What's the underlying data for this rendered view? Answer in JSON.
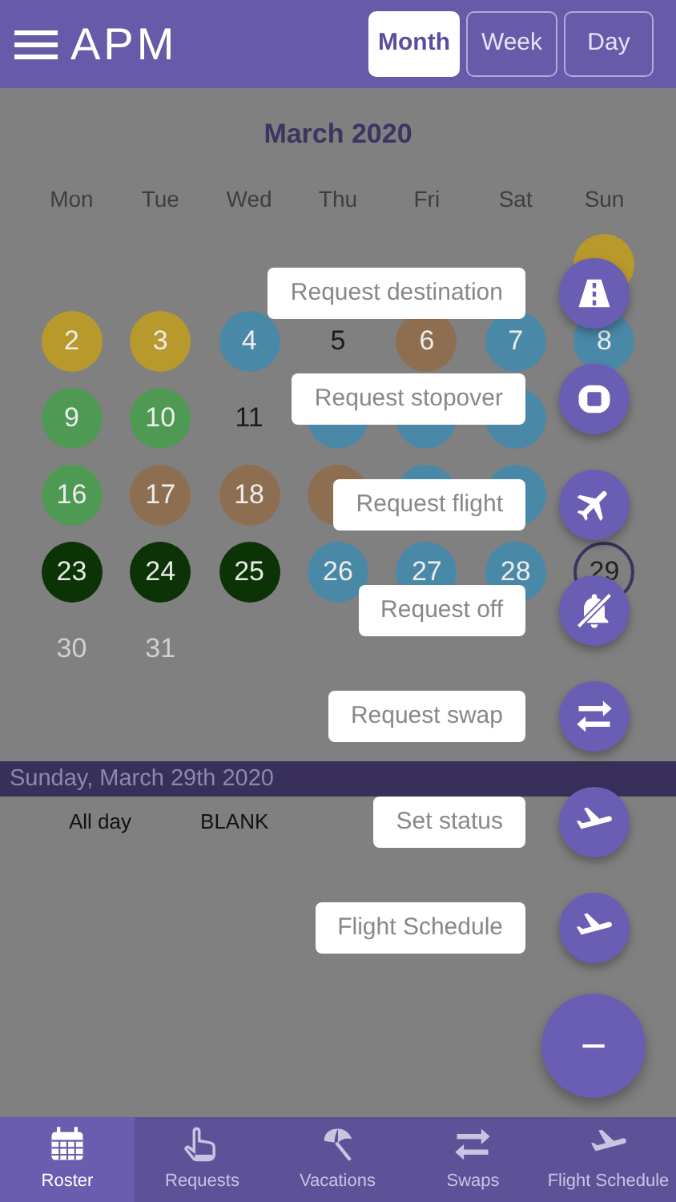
{
  "header": {
    "logo": "APM",
    "view_tabs": [
      {
        "label": "Month",
        "selected": true
      },
      {
        "label": "Week",
        "selected": false
      },
      {
        "label": "Day",
        "selected": false
      }
    ]
  },
  "calendar": {
    "title": "March 2020",
    "weekdays": [
      "Mon",
      "Tue",
      "Wed",
      "Thu",
      "Fri",
      "Sat",
      "Sun"
    ],
    "weeks": [
      [
        {
          "kind": "blank"
        },
        {
          "kind": "blank"
        },
        {
          "kind": "blank"
        },
        {
          "kind": "blank"
        },
        {
          "kind": "blank"
        },
        {
          "kind": "blank"
        },
        {
          "kind": "circle",
          "color": "#b8992c"
        }
      ],
      [
        {
          "kind": "circle",
          "day": "2",
          "color": "#b8992c"
        },
        {
          "kind": "circle",
          "day": "3",
          "color": "#b8992c"
        },
        {
          "kind": "circle",
          "day": "4",
          "color": "#4a88a8"
        },
        {
          "kind": "plain",
          "day": "5"
        },
        {
          "kind": "circle",
          "day": "6",
          "color": "#8e6e50"
        },
        {
          "kind": "circle",
          "day": "7",
          "color": "#4a88a8"
        },
        {
          "kind": "circle",
          "day": "8",
          "color": "#4a88a8"
        }
      ],
      [
        {
          "kind": "circle",
          "day": "9",
          "color": "#4e9a52"
        },
        {
          "kind": "circle",
          "day": "10",
          "color": "#4e9a52"
        },
        {
          "kind": "plain",
          "day": "11"
        },
        {
          "kind": "circle",
          "color": "#4a88a8"
        },
        {
          "kind": "circle",
          "color": "#4a88a8"
        },
        {
          "kind": "circle",
          "color": "#4a88a8"
        },
        {
          "kind": "blank"
        }
      ],
      [
        {
          "kind": "circle",
          "day": "16",
          "color": "#4e9a52"
        },
        {
          "kind": "circle",
          "day": "17",
          "color": "#8e6e50"
        },
        {
          "kind": "circle",
          "day": "18",
          "color": "#8e6e50"
        },
        {
          "kind": "circle",
          "color": "#8e6e50"
        },
        {
          "kind": "circle",
          "color": "#4a88a8"
        },
        {
          "kind": "circle",
          "color": "#4a88a8"
        },
        {
          "kind": "blank"
        }
      ],
      [
        {
          "kind": "strong",
          "day": "23",
          "color": "#0b3306"
        },
        {
          "kind": "strong",
          "day": "24",
          "color": "#0b3306"
        },
        {
          "kind": "strong",
          "day": "25",
          "color": "#0b3306"
        },
        {
          "kind": "circle",
          "day": "26",
          "color": "#4a88a8"
        },
        {
          "kind": "circle",
          "day": "27",
          "color": "#4a88a8"
        },
        {
          "kind": "circle",
          "day": "28",
          "color": "#4a88a8"
        },
        {
          "kind": "today",
          "day": "29"
        }
      ],
      [
        {
          "kind": "muted",
          "day": "30"
        },
        {
          "kind": "muted",
          "day": "31"
        },
        {
          "kind": "blank"
        },
        {
          "kind": "blank"
        },
        {
          "kind": "blank"
        },
        {
          "kind": "blank"
        },
        {
          "kind": "blank"
        }
      ]
    ]
  },
  "agenda": {
    "date": "Sunday, March 29th 2020",
    "events": [
      {
        "time": "All day",
        "title": "BLANK"
      }
    ]
  },
  "fab_menu": {
    "actions": [
      {
        "label": "Request destination",
        "kind": "road"
      },
      {
        "label": "Request stopover",
        "kind": "stop"
      },
      {
        "label": "Request flight",
        "kind": "plane"
      },
      {
        "label": "Request off",
        "kind": "bell-off"
      },
      {
        "label": "Request swap",
        "kind": "swap"
      },
      {
        "label": "Set status",
        "kind": "takeoff"
      },
      {
        "label": "Flight Schedule",
        "kind": "takeoff"
      }
    ],
    "toggle": "−"
  },
  "bottom_nav": [
    {
      "label": "Roster",
      "kind": "calendar",
      "selected": true
    },
    {
      "label": "Requests",
      "kind": "hand",
      "selected": false
    },
    {
      "label": "Vacations",
      "kind": "umbrella",
      "selected": false
    },
    {
      "label": "Swaps",
      "kind": "swap",
      "selected": false
    },
    {
      "label": "Flight Schedule",
      "kind": "takeoff",
      "selected": false
    }
  ]
}
